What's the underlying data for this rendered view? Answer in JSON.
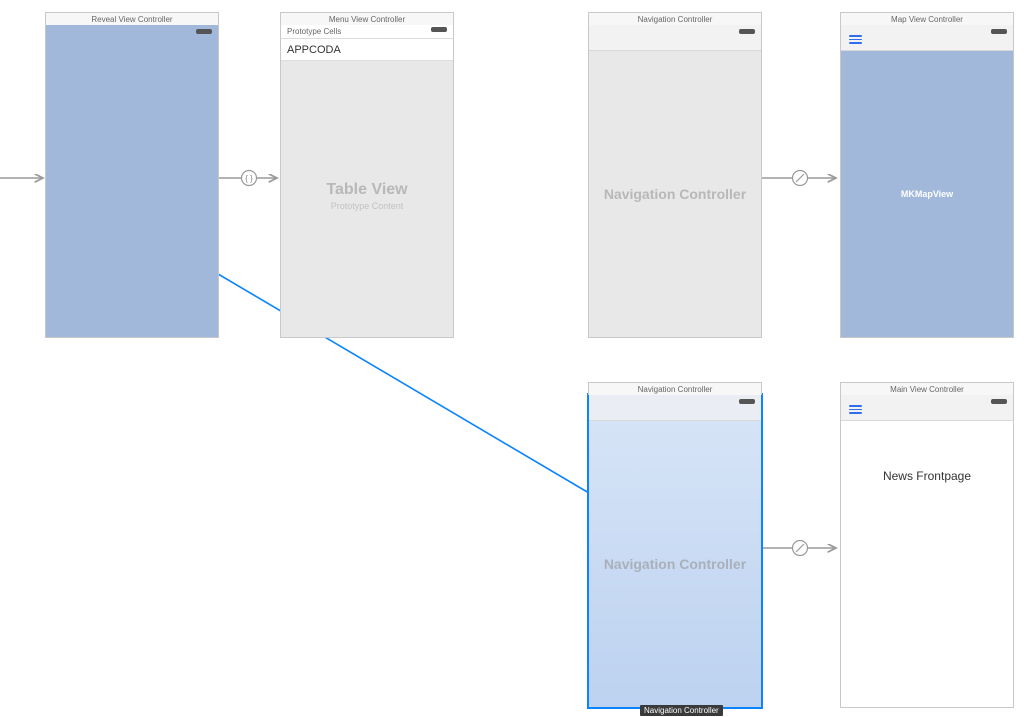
{
  "scenes": {
    "reveal": {
      "title": "Reveal View Controller"
    },
    "menu": {
      "title": "Menu View Controller",
      "proto_header": "Prototype Cells",
      "proto_cell": "APPCODA",
      "placeholder_main": "Table View",
      "placeholder_sub": "Prototype Content"
    },
    "nav1": {
      "title": "Navigation Controller",
      "placeholder": "Navigation Controller"
    },
    "map": {
      "title": "Map View Controller",
      "placeholder": "MKMapView"
    },
    "nav2": {
      "title": "Navigation Controller",
      "placeholder": "Navigation Controller",
      "tooltip": "Navigation Controller"
    },
    "main": {
      "title": "Main View Controller",
      "content": "News Frontpage"
    }
  }
}
